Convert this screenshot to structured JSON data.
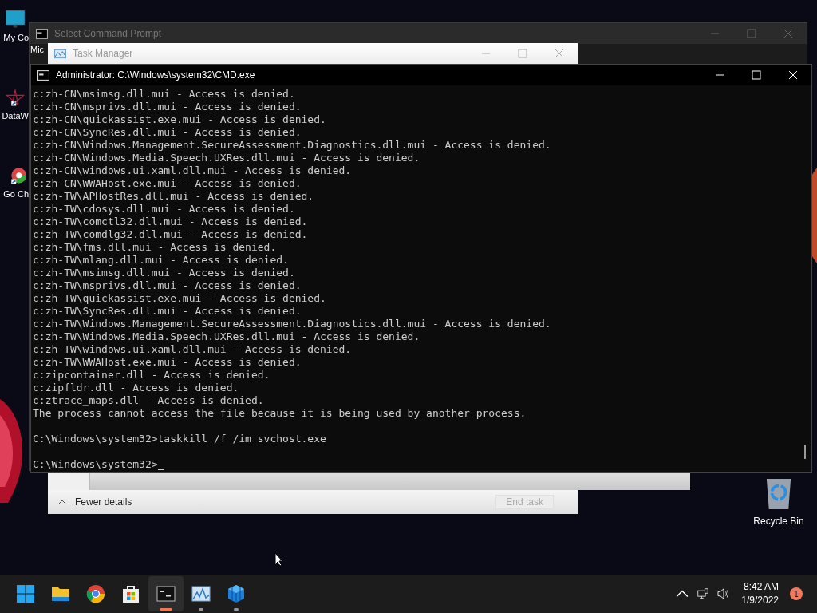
{
  "desktop": {
    "left_icons": [
      {
        "kind": "monitor",
        "label": "My Co"
      },
      {
        "kind": "star",
        "label": "DataW"
      },
      {
        "kind": "browser",
        "label": "Go Ch"
      }
    ],
    "hidden_icon_label": "Mic",
    "recycle_bin": {
      "label": "Recycle Bin"
    }
  },
  "back_window": {
    "title": "Select Command Prompt"
  },
  "task_manager": {
    "title": "Task Manager",
    "details_toggle": "Fewer details",
    "end_task": {
      "label": "End task",
      "disabled": true
    }
  },
  "console": {
    "title": "Administrator: C:\\Windows\\system32\\CMD.exe",
    "lines": [
      "c:zh-CN\\msimsg.dll.mui - Access is denied.",
      "c:zh-CN\\msprivs.dll.mui - Access is denied.",
      "c:zh-CN\\quickassist.exe.mui - Access is denied.",
      "c:zh-CN\\SyncRes.dll.mui - Access is denied.",
      "c:zh-CN\\Windows.Management.SecureAssessment.Diagnostics.dll.mui - Access is denied.",
      "c:zh-CN\\Windows.Media.Speech.UXRes.dll.mui - Access is denied.",
      "c:zh-CN\\windows.ui.xaml.dll.mui - Access is denied.",
      "c:zh-CN\\WWAHost.exe.mui - Access is denied.",
      "c:zh-TW\\APHostRes.dll.mui - Access is denied.",
      "c:zh-TW\\cdosys.dll.mui - Access is denied.",
      "c:zh-TW\\comctl32.dll.mui - Access is denied.",
      "c:zh-TW\\comdlg32.dll.mui - Access is denied.",
      "c:zh-TW\\fms.dll.mui - Access is denied.",
      "c:zh-TW\\mlang.dll.mui - Access is denied.",
      "c:zh-TW\\msimsg.dll.mui - Access is denied.",
      "c:zh-TW\\msprivs.dll.mui - Access is denied.",
      "c:zh-TW\\quickassist.exe.mui - Access is denied.",
      "c:zh-TW\\SyncRes.dll.mui - Access is denied.",
      "c:zh-TW\\Windows.Management.SecureAssessment.Diagnostics.dll.mui - Access is denied.",
      "c:zh-TW\\Windows.Media.Speech.UXRes.dll.mui - Access is denied.",
      "c:zh-TW\\windows.ui.xaml.dll.mui - Access is denied.",
      "c:zh-TW\\WWAHost.exe.mui - Access is denied.",
      "c:zipcontainer.dll - Access is denied.",
      "c:zipfldr.dll - Access is denied.",
      "c:ztrace_maps.dll - Access is denied.",
      "The process cannot access the file because it is being used by another process."
    ],
    "command": "C:\\Windows\\system32>taskkill /f /im svchost.exe",
    "prompt": "C:\\Windows\\system32>"
  },
  "taskbar": {
    "apps": [
      {
        "kind": "start",
        "running": false,
        "active": false
      },
      {
        "kind": "folder",
        "running": false,
        "active": false
      },
      {
        "kind": "chrome",
        "running": false,
        "active": false
      },
      {
        "kind": "store",
        "running": false,
        "active": false
      },
      {
        "kind": "terminal",
        "running": true,
        "active": true
      },
      {
        "kind": "perf",
        "running": true,
        "active": false
      },
      {
        "kind": "cube",
        "running": true,
        "active": false
      }
    ],
    "time": "8:42 AM",
    "date": "1/9/2022",
    "notification_count": "1"
  }
}
